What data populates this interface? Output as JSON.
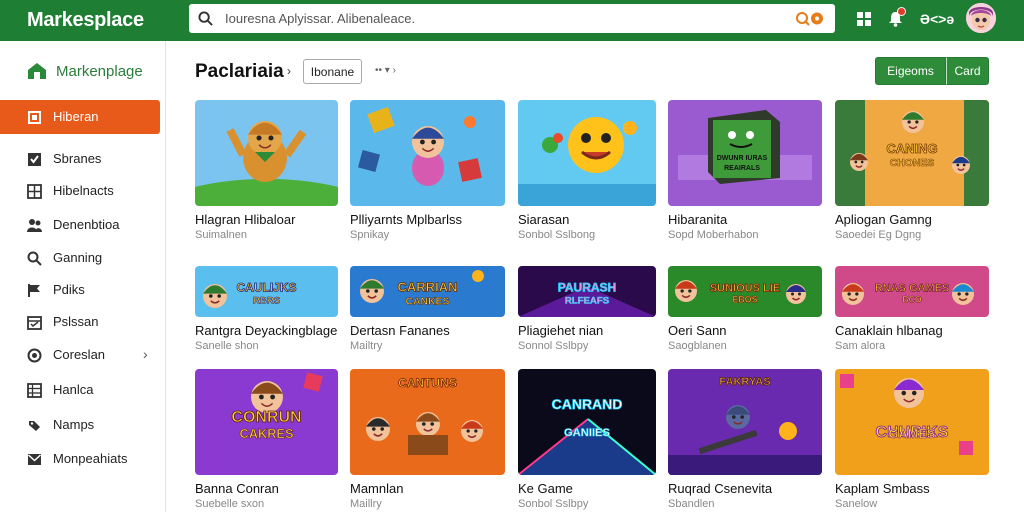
{
  "app": {
    "logo": "Markesplace"
  },
  "search": {
    "placeholder": "Iouresna Aplyissar. Alibenaleace."
  },
  "topbar": {
    "apps_icon": "grid-icon",
    "notif_icon": "bell-icon",
    "account_label": "Ə<>ə"
  },
  "sidebar": {
    "brand": "Markenplage",
    "items": [
      {
        "label": "Hiberan",
        "icon": "store-icon",
        "active": true
      },
      {
        "label": "Sbranes",
        "icon": "check-box-icon"
      },
      {
        "label": "Hibelnacts",
        "icon": "grid-icon"
      },
      {
        "label": "Denenbtioa",
        "icon": "people-icon"
      },
      {
        "label": "Ganning",
        "icon": "search-icon"
      },
      {
        "label": "Pdiks",
        "icon": "flag-icon"
      },
      {
        "label": "Pslssan",
        "icon": "calendar-icon"
      },
      {
        "label": "Coreslan",
        "icon": "circle-icon",
        "has_chevron": true
      },
      {
        "label": "Hanlca",
        "icon": "table-icon"
      },
      {
        "label": "Namps",
        "icon": "tag-icon"
      },
      {
        "label": "Monpeahiats",
        "icon": "mail-icon"
      }
    ]
  },
  "header": {
    "title": "Paclariaia",
    "separator": "›",
    "filter_chip": "Ibonane",
    "sort_dropdown": "•• ▾ ›",
    "btn_primary": "Eigeoms",
    "btn_secondary": "Card"
  },
  "cards": [
    {
      "title": "Hlagran Hlibaloar",
      "subtitle": "Suimalnen",
      "theme": "bear"
    },
    {
      "title": "Plliyarnts Mplbarlss",
      "subtitle": "Spnikay",
      "theme": "boy"
    },
    {
      "title": "Siarasan",
      "subtitle": "Sonbol Sslbong",
      "theme": "sun"
    },
    {
      "title": "Hibaranita",
      "subtitle": "Sopd Moberhabon",
      "theme": "box"
    },
    {
      "title": "Apliogan Gamng",
      "subtitle": "Saoedei Eg Dgng",
      "theme": "adventure"
    },
    {
      "title": "Rantgra Deyackingblage",
      "subtitle": "Sanelle shon",
      "theme": "casual"
    },
    {
      "title": "Dertasn Fananes",
      "subtitle": "Mailtry",
      "theme": "casual2"
    },
    {
      "title": "Pliagiehet nian",
      "subtitle": "Sonnol Sslbpy",
      "theme": "neon"
    },
    {
      "title": "Oeri Sann",
      "subtitle": "Saogblanen",
      "theme": "green"
    },
    {
      "title": "Canaklain hlbanag",
      "subtitle": "Sam alora",
      "theme": "heroes"
    },
    {
      "title": "Banna Conran",
      "subtitle": "Suebelle sxon",
      "theme": "purple"
    },
    {
      "title": "Mamnlan",
      "subtitle": "Maillry",
      "theme": "orange"
    },
    {
      "title": "Ke Game",
      "subtitle": "Sonbol Sslbpy",
      "theme": "arcade"
    },
    {
      "title": "Ruqrad Csenevita",
      "subtitle": "Sbandlen",
      "theme": "blaster"
    },
    {
      "title": "Kaplam Smbass",
      "subtitle": "Sanelow",
      "theme": "chess"
    }
  ],
  "banners": {
    "casual": "CAULIJKS RBRS",
    "casual2": "CARRIAN CANKES",
    "neon": "PAURASH RLFEAFS",
    "green": "SUNIOUS LIE EBOS",
    "heroes": "RNAS GAMES BCO",
    "purple": "CONRUN CAKRES",
    "orange": "CANTUNS",
    "arcade": "CANRAND GANIIES",
    "blaster": "FAKRYAS",
    "chess": "CHURIKS GAMES",
    "box": "DWUNR IURAS REAIRALS",
    "adventure": "CANING CHONES"
  },
  "colors": {
    "brand_green": "#1e7f34",
    "accent_orange": "#e85a1a",
    "button_green": "#2e8b3a"
  }
}
